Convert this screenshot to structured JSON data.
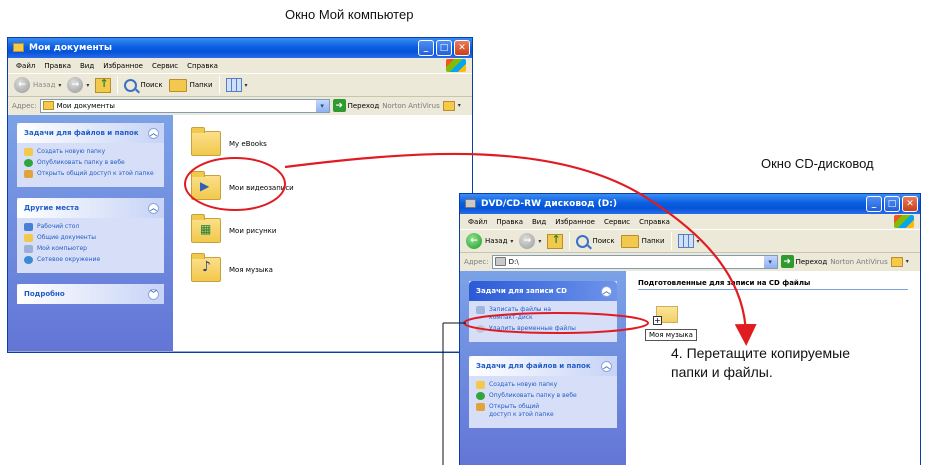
{
  "captions": {
    "top": "Окно Мой компьютер",
    "right": "Окно CD-дисковод"
  },
  "instruction": {
    "line1": "4. Перетащите копируемые",
    "line2": "папки и файлы."
  },
  "colors": {
    "titlebar": "#0a5fe0",
    "annotation": "#e11b22",
    "link": "#215dc6"
  },
  "win1": {
    "title": "Мои документы",
    "menu": [
      "Файл",
      "Правка",
      "Вид",
      "Избранное",
      "Сервис",
      "Справка"
    ],
    "toolbar": {
      "back": "Назад",
      "search": "Поиск",
      "folders": "Папки"
    },
    "address": {
      "label": "Адрес:",
      "value": "Мои документы",
      "go": "Переход",
      "norton": "Norton AntiVirus"
    },
    "tasks": {
      "header": "Задачи для файлов и папок",
      "items": [
        "Создать новую папку",
        "Опубликовать папку в вебе",
        "Открыть общий доступ к этой папке"
      ]
    },
    "places": {
      "header": "Другие места",
      "items": [
        "Рабочий стол",
        "Общие документы",
        "Мой компьютер",
        "Сетевое окружение"
      ]
    },
    "details": {
      "header": "Подробно"
    },
    "files": [
      "My eBooks",
      "Мои видеозаписи",
      "Мои рисунки",
      "Моя музыка"
    ]
  },
  "win2": {
    "title": "DVD/CD-RW дисковод (D:)",
    "menu": [
      "Файл",
      "Правка",
      "Вид",
      "Избранное",
      "Сервис",
      "Справка"
    ],
    "toolbar": {
      "back": "Назад",
      "search": "Поиск",
      "folders": "Папки"
    },
    "address": {
      "label": "Адрес:",
      "value": "D:\\",
      "go": "Переход",
      "norton": "Norton AntiVirus"
    },
    "cd_tasks": {
      "header": "Задачи для записи CD",
      "items": [
        "Записать файлы на компакт-диск",
        "Удалить временные файлы"
      ]
    },
    "tasks": {
      "header": "Задачи для файлов и папок",
      "items": [
        "Создать новую папку",
        "Опубликовать папку в вебе",
        "Открыть общий доступ к этой папке"
      ]
    },
    "content_header": "Подготовленные для записи на CD файлы",
    "drag_label": "Моя музыка"
  }
}
